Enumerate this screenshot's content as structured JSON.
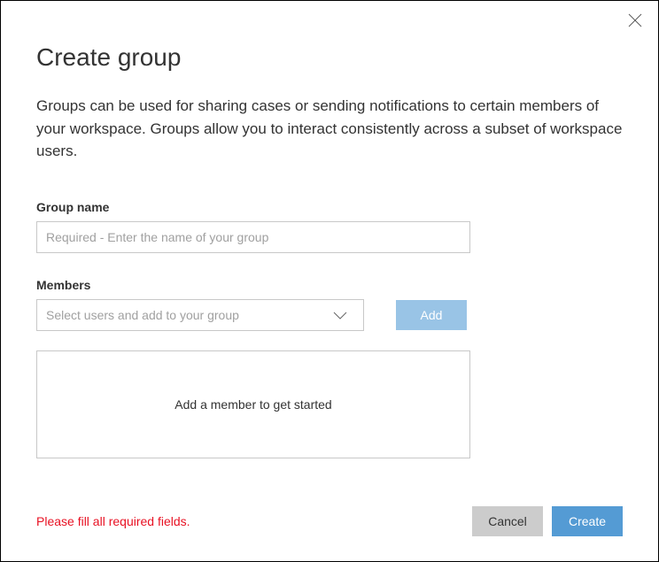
{
  "title": "Create group",
  "description": "Groups can be used for sharing cases or sending notifications to certain members of your workspace. Groups allow you to interact consistently across a subset of workspace users.",
  "groupName": {
    "label": "Group name",
    "placeholder": "Required - Enter the name of your group",
    "value": ""
  },
  "members": {
    "label": "Members",
    "selectPlaceholder": "Select users and add to your group",
    "addButton": "Add",
    "emptyMessage": "Add a member to get started"
  },
  "error": "Please fill all required fields.",
  "buttons": {
    "cancel": "Cancel",
    "create": "Create"
  }
}
